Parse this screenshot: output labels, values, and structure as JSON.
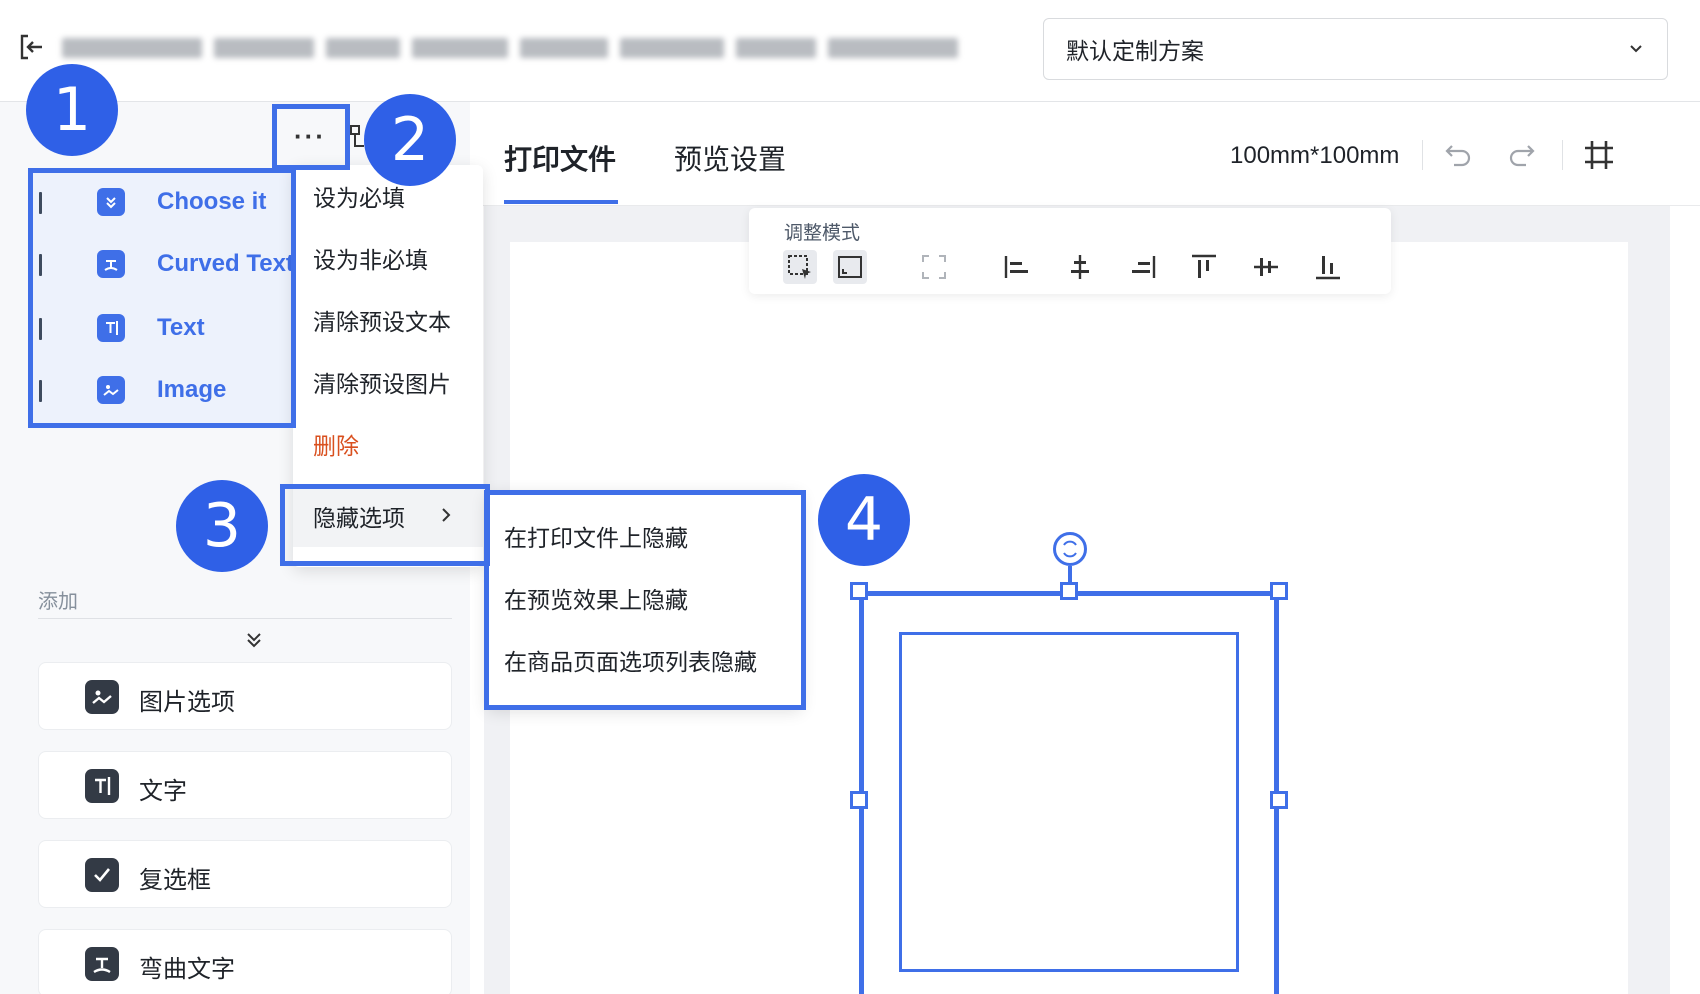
{
  "header": {
    "scheme_select_value": "默认定制方案"
  },
  "layers": {
    "items": [
      {
        "label": "Choose it",
        "icon": "chevron-double-icon"
      },
      {
        "label": "Curved Text",
        "icon": "curved-text-icon"
      },
      {
        "label": "Text",
        "icon": "text-icon"
      },
      {
        "label": "Image",
        "icon": "image-icon"
      }
    ]
  },
  "more_button": {
    "label": "···"
  },
  "context_menu": {
    "items": [
      {
        "label": "设为必填"
      },
      {
        "label": "设为非必填"
      },
      {
        "label": "清除预设文本"
      },
      {
        "label": "清除预设图片"
      },
      {
        "label": "删除",
        "danger": true
      },
      {
        "label": "隐藏选项",
        "has_submenu": true
      }
    ]
  },
  "sub_menu": {
    "items": [
      {
        "label": "在打印文件上隐藏"
      },
      {
        "label": "在预览效果上隐藏"
      },
      {
        "label": "在商品页面选项列表隐藏"
      }
    ]
  },
  "add_section": {
    "title": "添加",
    "buttons": [
      {
        "label": "图片选项",
        "icon": "image-option-icon"
      },
      {
        "label": "文字",
        "icon": "text-icon"
      },
      {
        "label": "复选框",
        "icon": "checkbox-icon"
      },
      {
        "label": "弯曲文字",
        "icon": "curved-text-icon"
      }
    ]
  },
  "tabs": [
    {
      "label": "打印文件",
      "active": true
    },
    {
      "label": "预览设置",
      "active": false
    }
  ],
  "canvas_size": "100mm*100mm",
  "adjust_bar": {
    "title": "调整模式"
  },
  "annotations": [
    "1",
    "2",
    "3",
    "4"
  ],
  "colors": {
    "accent": "#3f6fe8",
    "badge": "#2f60e7",
    "danger": "#d9501f"
  }
}
